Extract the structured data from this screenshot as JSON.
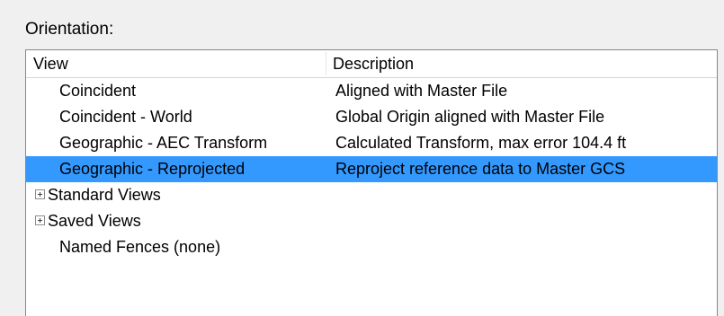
{
  "orientation_label": "Orientation:",
  "columns": {
    "view": "View",
    "description": "Description"
  },
  "colors": {
    "selection": "#3399ff",
    "border": "#828790",
    "background": "#f0f0f0"
  },
  "rows": [
    {
      "view": "Coincident",
      "description": "Aligned with Master File",
      "selected": false
    },
    {
      "view": "Coincident - World",
      "description": "Global Origin aligned with Master File",
      "selected": false
    },
    {
      "view": "Geographic - AEC Transform",
      "description": "Calculated Transform, max error 104.4 ft",
      "selected": false
    },
    {
      "view": "Geographic - Reprojected",
      "description": "Reproject reference data to Master GCS",
      "selected": true
    }
  ],
  "groups": [
    {
      "label": "Standard Views",
      "icon": "plus-expand-icon"
    },
    {
      "label": "Saved Views",
      "icon": "plus-expand-icon"
    }
  ],
  "named_fences": "Named Fences (none)"
}
